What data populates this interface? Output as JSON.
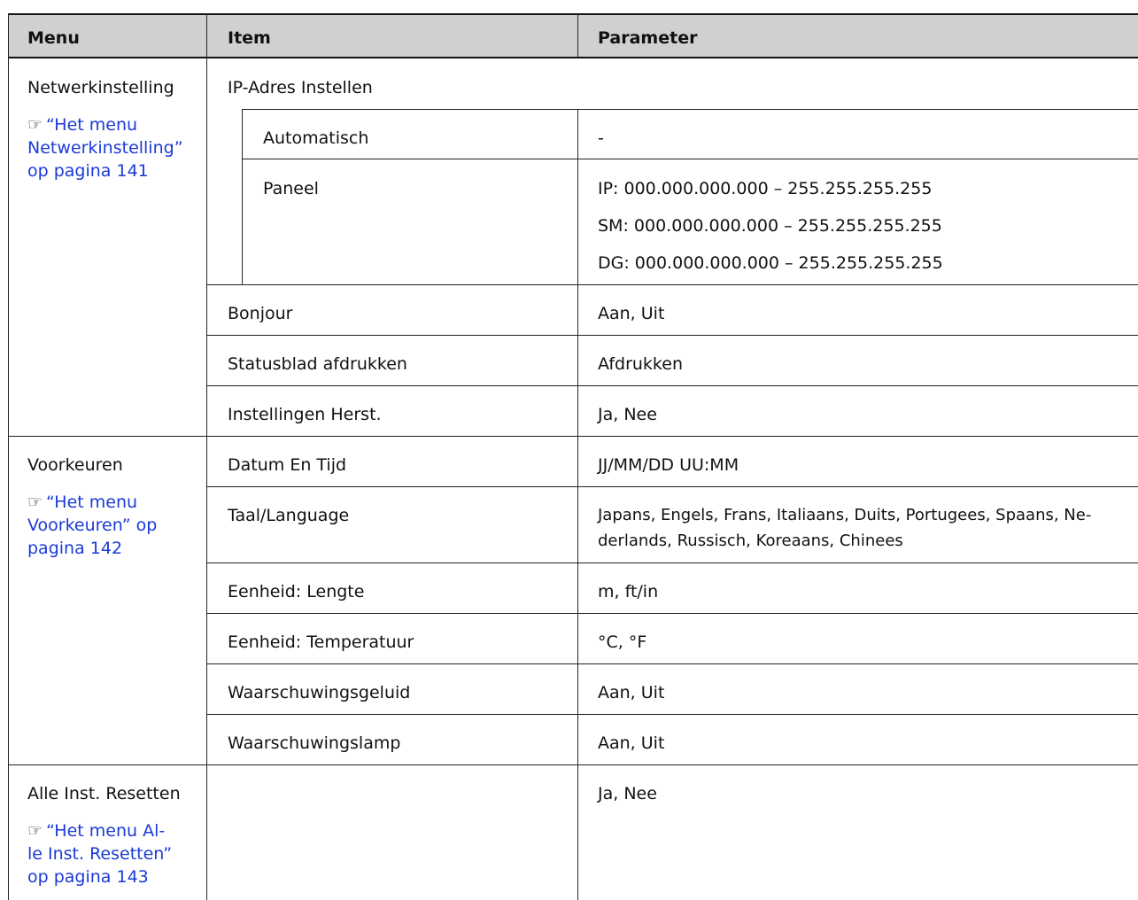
{
  "headers": {
    "menu": "Menu",
    "item": "Item",
    "parameter": "Parameter"
  },
  "group1": {
    "menu": "Netwerkinstelling",
    "ref_icon": "hand-pointer-icon",
    "ref_line1": "“Het menu",
    "ref_line2": "Netwerkinstelling”",
    "ref_line3": "op pagina 141",
    "ip_title": "IP-Adres Instellen",
    "auto_item": "Automatisch",
    "auto_param": "-",
    "panel_item": "Paneel",
    "ip_param": "IP: 000.000.000.000 – 255.255.255.255",
    "sm_param": "SM: 000.000.000.000 – 255.255.255.255",
    "dg_param": "DG: 000.000.000.000 – 255.255.255.255",
    "bonjour_item": "Bonjour",
    "bonjour_param": "Aan, Uit",
    "status_item": "Statusblad afdrukken",
    "status_param": "Afdrukken",
    "reset_item": "Instellingen Herst.",
    "reset_param": "Ja, Nee"
  },
  "group2": {
    "menu": "Voorkeuren",
    "ref_line1": "“Het menu",
    "ref_line2": "Voorkeuren” op",
    "ref_line3": "pagina 142",
    "date_item": "Datum En Tijd",
    "date_param": "JJ/MM/DD UU:MM",
    "lang_item": "Taal/Language",
    "lang_param_line1": "Japans, Engels, Frans, Italiaans, Duits, Portugees, Spaans, Ne-",
    "lang_param_line2": "derlands, Russisch, Koreaans, Chinees",
    "length_item": "Eenheid: Lengte",
    "length_param": "m, ft/in",
    "temp_item": "Eenheid: Temperatuur",
    "temp_param": "°C, °F",
    "sound_item": "Waarschuwingsgeluid",
    "sound_param": "Aan, Uit",
    "lamp_item": "Waarschuwingslamp",
    "lamp_param": "Aan, Uit"
  },
  "group3": {
    "menu": "Alle Inst. Resetten",
    "ref_line1": "“Het menu Al-",
    "ref_line2": "le Inst. Resetten”",
    "ref_line3": "op pagina 143",
    "param": "Ja, Nee"
  }
}
